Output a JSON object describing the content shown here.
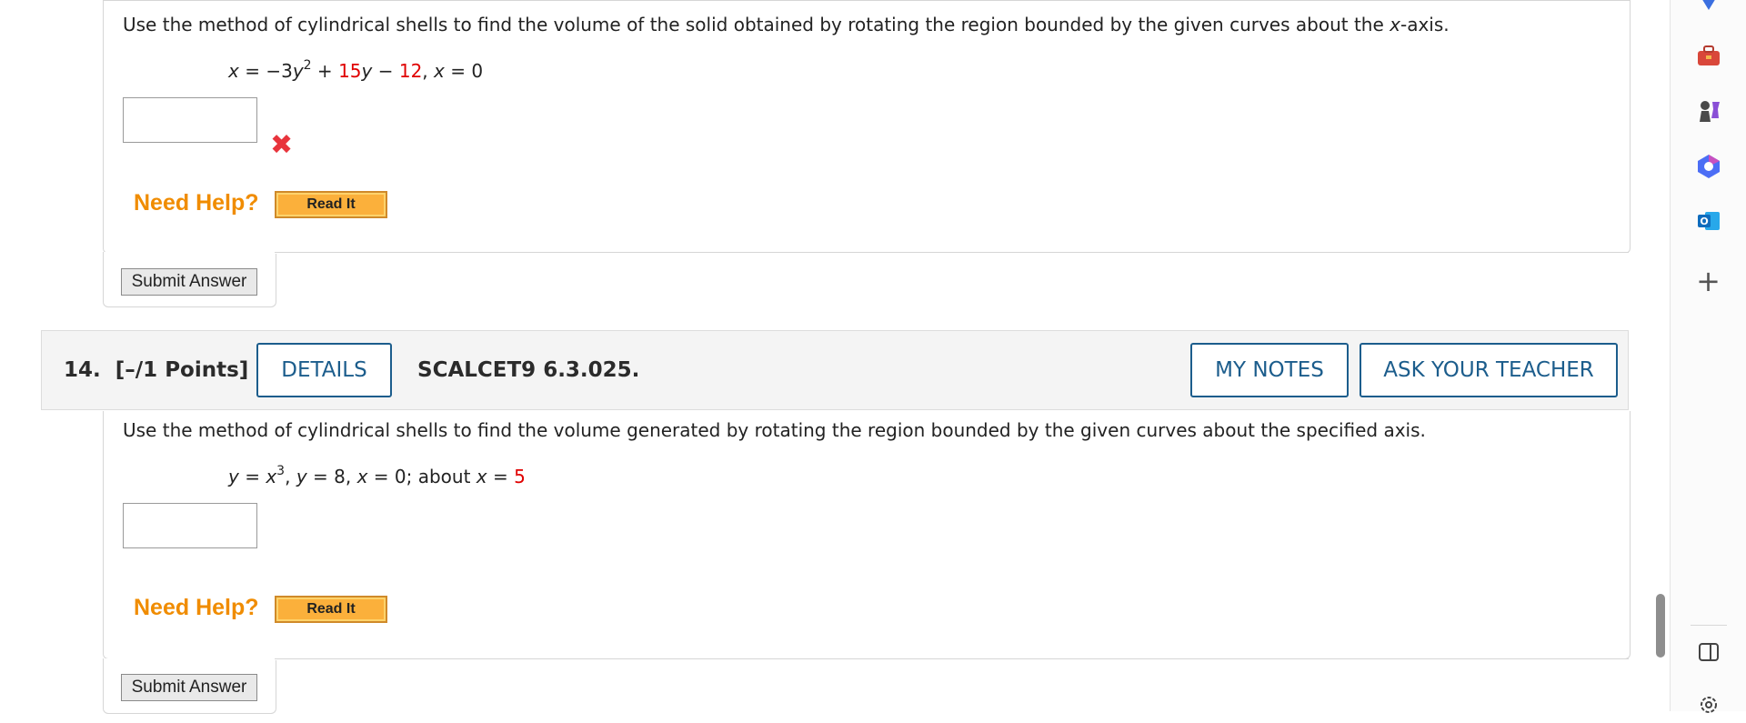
{
  "question_13": {
    "prompt_pre": "Use the method of cylindrical shells to find the volume of the solid obtained by rotating the region bounded by the given curves about the ",
    "prompt_axis_var": "x",
    "prompt_post": "-axis.",
    "eq": {
      "x1": "x",
      "eq1": " = −3",
      "y1": "y",
      "exp1": "2",
      "plus": " + ",
      "coef": "15",
      "y2": "y",
      "minus": " − ",
      "const": "12",
      "sep": ",  ",
      "x2": "x",
      "eq2": " = 0"
    },
    "answer_value": "",
    "wrong_icon": "✖",
    "need_help": "Need Help?",
    "read_it": "Read It",
    "submit": "Submit Answer"
  },
  "question_14": {
    "number": "14.",
    "points": "[–/1 Points]",
    "details": "DETAILS",
    "reference": "SCALCET9 6.3.025.",
    "my_notes": "MY NOTES",
    "ask_teacher": "ASK YOUR TEACHER",
    "prompt": "Use the method of cylindrical shells to find the volume generated by rotating the region bounded by the given curves about the specified axis.",
    "eq": {
      "y1": "y",
      "eq1": " = ",
      "x1": "x",
      "exp1": "3",
      "sep1": ",   ",
      "y2": "y",
      "eq2": " = 8,   ",
      "x2": "x",
      "eq3": " = 0;   about ",
      "x3": "x",
      "eq4": " = ",
      "val": "5"
    },
    "answer_value": "",
    "need_help": "Need Help?",
    "read_it": "Read It",
    "submit": "Submit Answer"
  },
  "sidebar": {
    "icons": [
      "diamond-icon",
      "toolbox-icon",
      "chess-icon",
      "copilot-icon",
      "outlook-icon",
      "plus-icon",
      "sidebar-toggle-icon",
      "settings-icon"
    ],
    "plus_glyph": "+",
    "outlook_letter": "O"
  },
  "colors": {
    "accent_blue": "#1c5d8c",
    "help_orange": "#f08c00",
    "wrong_red": "#e8343c",
    "param_red": "#e00000"
  }
}
